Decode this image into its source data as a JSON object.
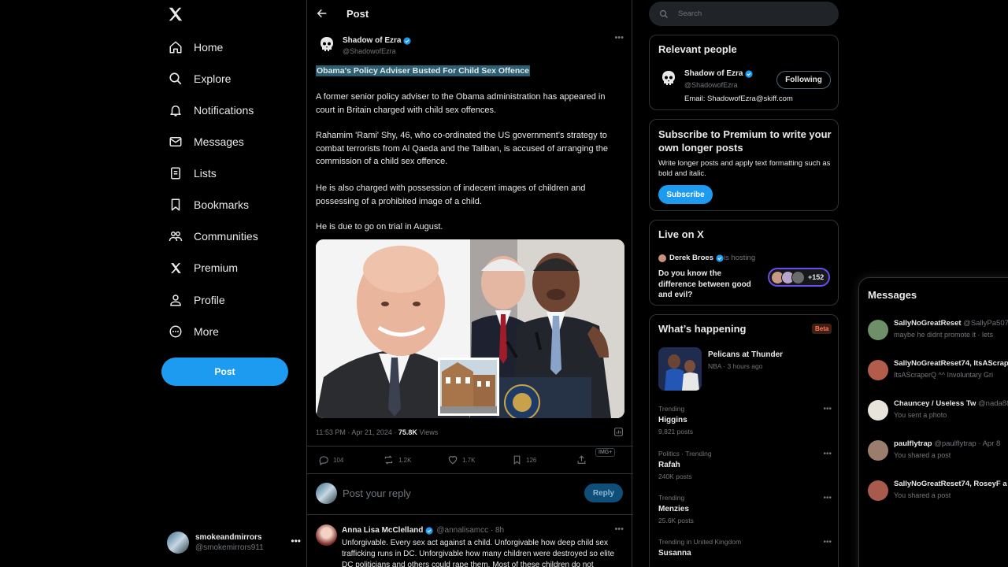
{
  "nav": {
    "items": [
      {
        "label": "Home",
        "icon": "home-icon"
      },
      {
        "label": "Explore",
        "icon": "search-icon"
      },
      {
        "label": "Notifications",
        "icon": "bell-icon"
      },
      {
        "label": "Messages",
        "icon": "envelope-icon"
      },
      {
        "label": "Lists",
        "icon": "list-icon"
      },
      {
        "label": "Bookmarks",
        "icon": "bookmark-icon"
      },
      {
        "label": "Communities",
        "icon": "people-icon"
      },
      {
        "label": "Premium",
        "icon": "x-logo-icon"
      },
      {
        "label": "Profile",
        "icon": "person-icon"
      },
      {
        "label": "More",
        "icon": "more-circle-icon"
      }
    ],
    "post_label": "Post",
    "account": {
      "name": "smokeandmirrors",
      "handle": "@smokemirrors911"
    }
  },
  "header": {
    "title": "Post"
  },
  "tweet": {
    "author": {
      "name": "Shadow of Ezra",
      "handle": "@ShadowofEzra"
    },
    "headline": "Obama's Policy Adviser Busted For Child Sex Offence",
    "paragraphs": [
      "A former senior policy adviser to the Obama administration has appeared in court in Britain charged with child sex offences.",
      "Rahamim 'Rami' Shy, 46, who co-ordinated the US government's strategy to combat terrorists from Al Qaeda and the Taliban, is accused of arranging the commission of a child sex offence.",
      "He is also charged with possession of indecent images of children and possessing of a prohibited image of a child.",
      "He is due to go on trial in August."
    ],
    "time": "11:53 PM · Apr 21, 2024 · ",
    "views_count": "75.8K",
    "views_label": " Views",
    "img_badge": "IMG+",
    "stats": {
      "replies": "104",
      "reposts": "1.2K",
      "likes": "1.7K",
      "bookmarks": "126"
    }
  },
  "reply": {
    "placeholder": "Post your reply",
    "button": "Reply"
  },
  "comment": {
    "name": "Anna Lisa McClelland",
    "handle": "@annalisamcc · 8h",
    "text": "Unforgivable. Every sex act against a child. Unforgivable how deep child sex trafficking runs in DC. Unforgivable how many children were destroyed so elite DC politicians and others could rape them. Most of these children do not"
  },
  "search": {
    "placeholder": "Search"
  },
  "relevant": {
    "title": "Relevant people",
    "name": "Shadow of Ezra",
    "handle": "@ShadowofEzra",
    "email": "Email: ShadowofEzra@skiff.com",
    "button": "Following"
  },
  "premium": {
    "title": "Subscribe to Premium to write your own longer posts",
    "text": "Write longer posts and apply text formatting such as bold and italic.",
    "button": "Subscribe"
  },
  "live": {
    "title": "Live on X",
    "host": "Derek Broes",
    "hosting": " is hosting",
    "question": "Do you know the difference between good and evil?",
    "count": "+152"
  },
  "happening": {
    "title": "What’s happening",
    "beta": "Beta",
    "event": {
      "name": "Pelicans at Thunder",
      "sub": "NBA · 3 hours ago"
    },
    "trends": [
      {
        "context": "Trending",
        "name": "Higgins",
        "posts": "9,821 posts"
      },
      {
        "context": "Politics · Trending",
        "name": "Rafah",
        "posts": "240K posts"
      },
      {
        "context": "Trending",
        "name": "Menzies",
        "posts": "25.6K posts"
      },
      {
        "context": "Trending in United Kingdom",
        "name": "Susanna",
        "posts": ""
      }
    ]
  },
  "messages": {
    "title": "Messages",
    "items": [
      {
        "name": "SallyNoGreatReset",
        "handle": " @SallyPa507",
        "preview": "maybe he didnt promote it · lets"
      },
      {
        "name": "SallyNoGreatReset74, ItsAScrap",
        "handle": "",
        "preview": "ItsAScraperQ ^^ Involuntary Gri"
      },
      {
        "name": "Chauncey / Useless Tw",
        "handle": " @nada88",
        "preview": "You sent a photo"
      },
      {
        "name": "paulflytrap",
        "handle": " @paulflytrap · Apr 8",
        "preview": "You shared a post"
      },
      {
        "name": "SallyNoGreatReset74, RoseyF a",
        "handle": "",
        "preview": "You shared a post"
      }
    ]
  },
  "colors": {
    "accent": "#1d9bf0",
    "background": "#000000",
    "border": "#2f3336",
    "muted": "#71767b",
    "live_ring": "#6d4ce8"
  }
}
